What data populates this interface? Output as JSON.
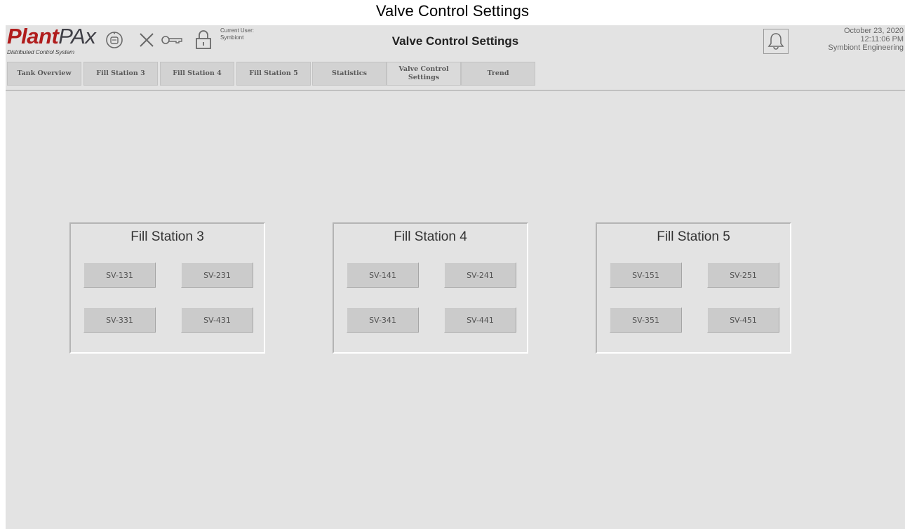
{
  "window_caption": "Valve Control Settings",
  "header": {
    "logo_main_a": "Plant",
    "logo_main_b": "PAx",
    "logo_sub": "Distributed Control System",
    "user_label": "Current User:",
    "user_name": "Symbiont",
    "title": "Valve Control Settings",
    "date": "October 23, 2020",
    "time": "12:11:06 PM",
    "company": "Symbiont Engineering",
    "icons": [
      "refresh-icon",
      "close-icon",
      "key-icon",
      "lock-icon",
      "bell-icon"
    ]
  },
  "nav": {
    "items": [
      {
        "label": "Tank Overview"
      },
      {
        "label": "Fill Station 3"
      },
      {
        "label": "Fill Station 4"
      },
      {
        "label": "Fill Station 5"
      },
      {
        "label": "Statistics"
      },
      {
        "label": "Valve Control\nSettings"
      },
      {
        "label": "Trend"
      }
    ]
  },
  "stations": [
    {
      "title": "Fill Station 3",
      "valves": [
        "SV-131",
        "SV-231",
        "SV-331",
        "SV-431"
      ]
    },
    {
      "title": "Fill Station 4",
      "valves": [
        "SV-141",
        "SV-241",
        "SV-341",
        "SV-441"
      ]
    },
    {
      "title": "Fill Station 5",
      "valves": [
        "SV-151",
        "SV-251",
        "SV-351",
        "SV-451"
      ]
    }
  ],
  "colors": {
    "background": "#e3e3e3",
    "logo_red": "#b01c1c",
    "button": "#cbcbcb"
  }
}
